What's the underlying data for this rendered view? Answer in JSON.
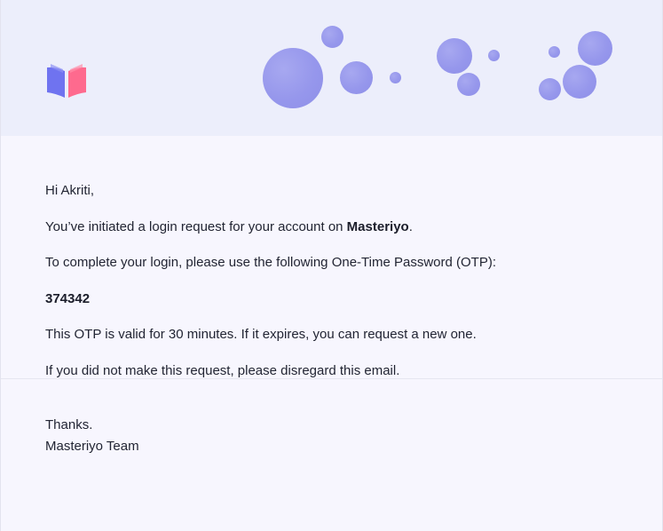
{
  "header": {
    "logo_icon": "masteriyo-book-logo-icon",
    "decoration": "bubble-decoration"
  },
  "colors": {
    "header_bg": "#eceefb",
    "body_bg": "#f7f6fe",
    "bubble": "#9697ec",
    "logo_left": "#6f73f0",
    "logo_right": "#fe6a8e"
  },
  "body": {
    "greeting": "Hi Akriti,",
    "intro_prefix": "You’ve initiated a login request for your account on ",
    "site_name": "Masteriyo",
    "intro_suffix": ".",
    "instruction": "To complete your login, please use the following One-Time Password (OTP):",
    "otp": "374342",
    "validity": "This OTP is valid for 30 minutes. If it expires, you can request a new one.",
    "disregard": "If you did not make this request, please disregard this email."
  },
  "footer": {
    "thanks": "Thanks.",
    "signature": "Masteriyo Team"
  }
}
